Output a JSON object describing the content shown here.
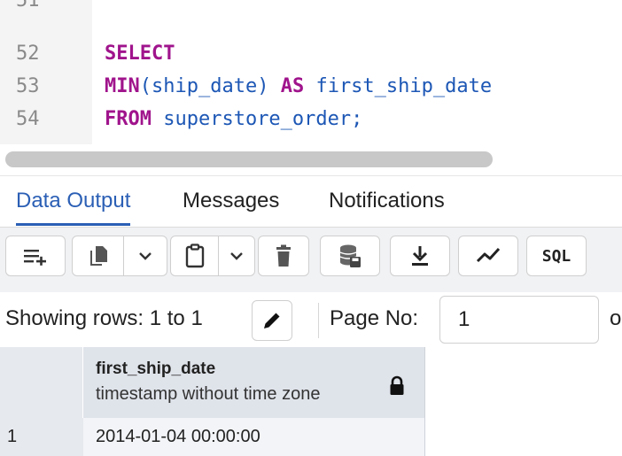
{
  "editor": {
    "lines": [
      {
        "num": "51",
        "parts": []
      },
      {
        "num": "52",
        "parts": [
          {
            "t": "SELECT",
            "k": "kw"
          }
        ]
      },
      {
        "num": "53",
        "parts": [
          {
            "t": "MIN",
            "k": "kw"
          },
          {
            "t": "(ship_date) ",
            "k": "id"
          },
          {
            "t": "AS",
            "k": "kw"
          },
          {
            "t": " first_ship_date",
            "k": "id"
          }
        ]
      },
      {
        "num": "54",
        "parts": [
          {
            "t": "FROM",
            "k": "kw"
          },
          {
            "t": " superstore_order;",
            "k": "id"
          }
        ]
      }
    ]
  },
  "tabs": [
    {
      "label": "Data Output",
      "active": true
    },
    {
      "label": "Messages",
      "active": false
    },
    {
      "label": "Notifications",
      "active": false
    }
  ],
  "toolbar": {
    "add_row_icon": "add-row-icon",
    "copy_icon": "copy-icon",
    "paste_icon": "paste-icon",
    "delete_icon": "delete-icon",
    "save_data_icon": "save-data-icon",
    "download_icon": "download-icon",
    "graph_icon": "graph-icon",
    "sql_label": "SQL"
  },
  "pager": {
    "showing_text": "Showing rows: 1 to 1",
    "page_no_label": "Page No:",
    "page_no_value": "1",
    "of_text": "o"
  },
  "grid": {
    "columns": [
      {
        "name": "first_ship_date",
        "type": "timestamp without time zone"
      }
    ],
    "rows": [
      {
        "num": "1",
        "values": [
          "2014-01-04 00:00:00"
        ]
      }
    ]
  },
  "colors": {
    "keyword": "#a0148c",
    "identifier": "#1d57b5",
    "accent": "#2b5fb5"
  }
}
